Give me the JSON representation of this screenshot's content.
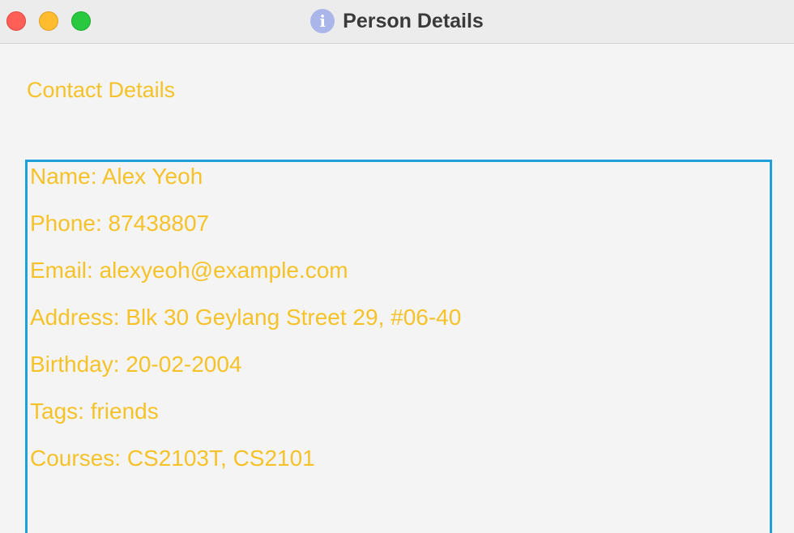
{
  "window": {
    "title": "Person Details",
    "icon": "info-icon",
    "controls": [
      "close",
      "minimize",
      "maximize"
    ]
  },
  "section": {
    "heading": "Contact Details"
  },
  "details": {
    "name": "Name: Alex Yeoh",
    "phone": "Phone: 87438807",
    "email": "Email: alexyeoh@example.com",
    "address": "Address: Blk 30 Geylang Street 29, #06-40",
    "birthday": "Birthday: 20-02-2004",
    "tags": "Tags: friends",
    "courses": "Courses: CS2103T, CS2101"
  },
  "colors": {
    "accent_text": "#f5c22a",
    "box_border": "#1fa0d8",
    "background": "#f4f4f4",
    "title_text": "#3a3a3a",
    "info_icon": "#aab6ea"
  }
}
